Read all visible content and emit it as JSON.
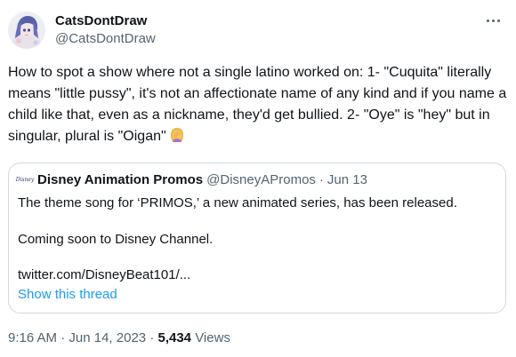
{
  "author": {
    "name": "CatsDontDraw",
    "handle": "@CatsDontDraw",
    "avatar_icon": "anime-character-avatar-icon"
  },
  "tweet": {
    "text": "How to spot a show where not a single latino worked on: 1- \"Cuquita\" literally means \"little pussy\", it's not an affectionate name of any kind and if you name a child like that, even as a nickname, they'd get bullied. 2- \"Oye\" is \"hey\" but in singular, plural is \"Oigan\"",
    "emoji_icon": "woman-facepalming-emoji"
  },
  "quoted": {
    "name": "Disney Animation Promos",
    "handle": "@DisneyAPromos",
    "separator": "·",
    "date": "Jun 13",
    "avatar_text": "Disney",
    "line1": "The theme song for ‘PRIMOS,’ a new animated series, has been released.",
    "line2": "Coming soon to Disney Channel.",
    "link": "twitter.com/DisneyBeat101/...",
    "show_thread": "Show this thread"
  },
  "meta": {
    "time": "9:16 AM",
    "sep1": "·",
    "date": "Jun 14, 2023",
    "sep2": "·",
    "views_count": "5,434",
    "views_label": "Views"
  },
  "colors": {
    "text": "#0f1419",
    "secondary": "#536471",
    "link": "#1d9bf0",
    "border": "#cfd9de"
  }
}
